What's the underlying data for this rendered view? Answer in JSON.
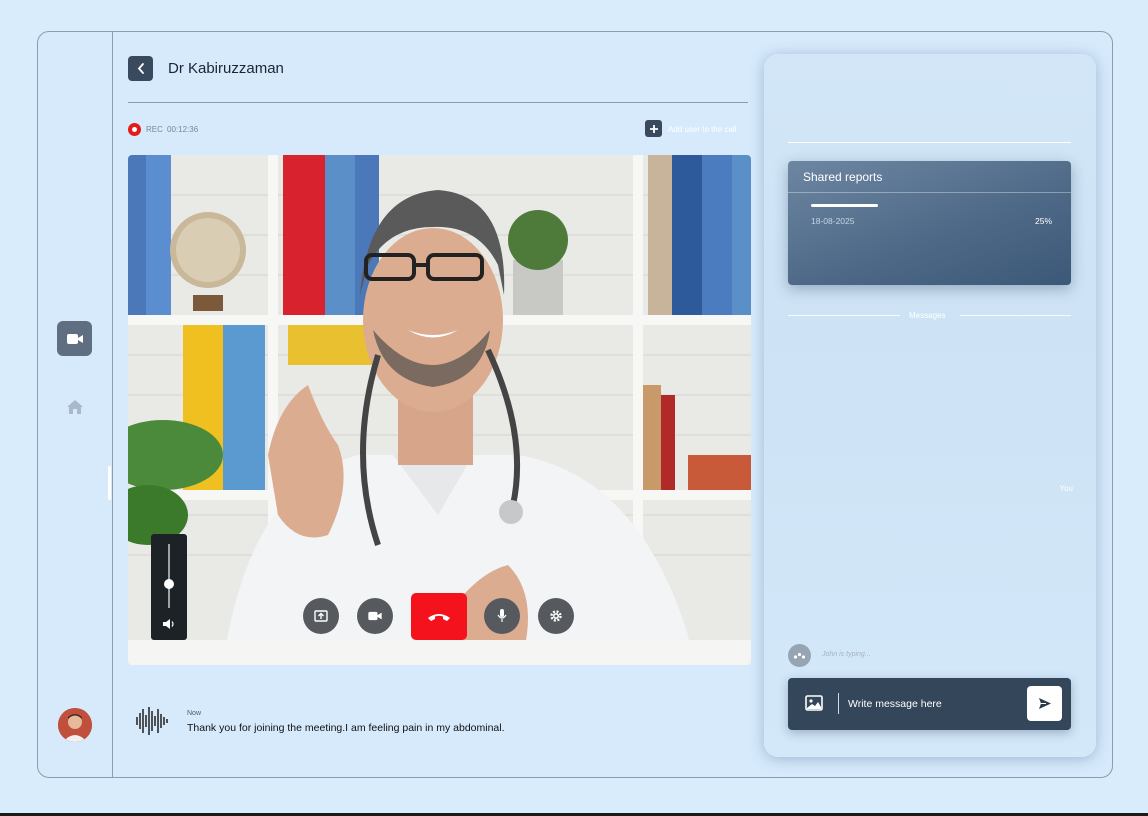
{
  "header": {
    "caller_name": "Dr Kabiruzzaman"
  },
  "recording": {
    "label": "REC",
    "timer": "00:12:36"
  },
  "add_user": {
    "label": "Add user to the call"
  },
  "video": {
    "volume_level": 0.37,
    "controls": [
      "share-screen-icon",
      "video-camera-icon",
      "end-call-icon",
      "microphone-icon",
      "settings-icon"
    ]
  },
  "transcript": {
    "time": "Now",
    "text": "Thank you for joining the meeting.I am feeling pain in my abdominal."
  },
  "shared_reports": {
    "title": "Shared reports",
    "items": [
      {
        "date": "18-08-2025",
        "progress_label": "25%",
        "progress": 0.28
      }
    ]
  },
  "messages": {
    "section_label": "Messages",
    "you_label": "You",
    "typing_indicator": "John is typing..."
  },
  "composer": {
    "placeholder": "Write message here"
  },
  "colors": {
    "background": "#d8ecfc",
    "end_call": "#f4121c",
    "recording": "#e21b1b",
    "dark_accent": "#34465a"
  }
}
